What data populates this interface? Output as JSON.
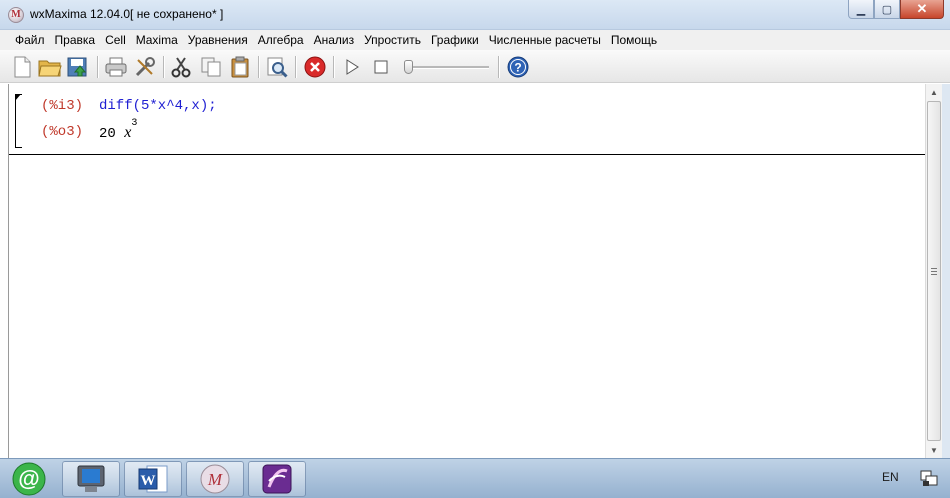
{
  "window": {
    "title": "wxMaxima 12.04.0[ не сохранено* ]",
    "buttons": {
      "minimize": "▁",
      "maximize": "▢",
      "close": "✕"
    }
  },
  "menu": [
    "Файл",
    "Правка",
    "Cell",
    "Maxima",
    "Уравнения",
    "Алгебра",
    "Анализ",
    "Упростить",
    "Графики",
    "Численные расчеты",
    "Помощь"
  ],
  "toolbar": {
    "icons": [
      "new-file-icon",
      "open-folder-icon",
      "save-icon",
      "print-icon",
      "configure-icon",
      "cut-icon",
      "copy-icon",
      "paste-icon",
      "find-icon",
      "interrupt-icon",
      "play-icon",
      "stop-icon",
      "animation-slider",
      "help-icon"
    ],
    "animation_slider_value": 0
  },
  "document": {
    "input_label": "(%i3)",
    "input_code": "diff(5*x^4,x);",
    "output_label": "(%o3)",
    "output_coefficient": "20",
    "output_variable": "x",
    "output_exponent": "3"
  },
  "taskbar": {
    "apps": [
      "mail-agent-icon",
      "computer-icon",
      "word-icon",
      "wxmaxima-icon",
      "app-icon"
    ],
    "language": "EN"
  },
  "colors": {
    "label": "#c0392b",
    "input": "#1e1ed2",
    "output": "#000000"
  }
}
